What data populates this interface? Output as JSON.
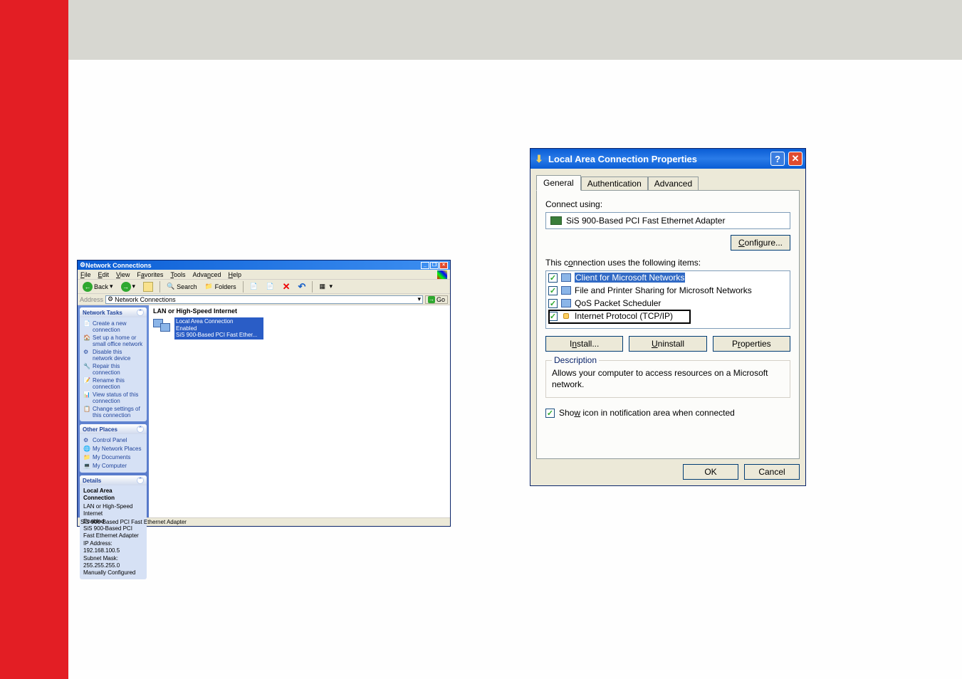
{
  "nc": {
    "title": "Network Connections",
    "menu": {
      "file": "File",
      "edit": "Edit",
      "view": "View",
      "fav": "Favorites",
      "tools": "Tools",
      "adv": "Advanced",
      "help": "Help"
    },
    "tool": {
      "back": "Back",
      "search": "Search",
      "folders": "Folders"
    },
    "addr": {
      "label": "Address",
      "value": "Network Connections",
      "go": "Go"
    },
    "tasks": {
      "title": "Network Tasks",
      "items": [
        "Create a new connection",
        "Set up a home or small office network",
        "Disable this network device",
        "Repair this connection",
        "Rename this connection",
        "View status of this connection",
        "Change settings of this connection"
      ]
    },
    "places": {
      "title": "Other Places",
      "items": [
        "Control Panel",
        "My Network Places",
        "My Documents",
        "My Computer"
      ]
    },
    "details": {
      "title": "Details",
      "name": "Local Area Connection",
      "type": "LAN or High-Speed Internet",
      "status": "Enabled",
      "device": "SiS 900-Based PCI Fast Ethernet Adapter",
      "ip": "IP Address: 192.168.100.5",
      "mask": "Subnet Mask: 255.255.255.0",
      "cfg": "Manually Configured"
    },
    "content": {
      "category": "LAN or High-Speed Internet",
      "item_name": "Local Area Connection",
      "item_status": "Enabled",
      "item_device": "SiS 900-Based PCI Fast Ether..."
    },
    "status": "SiS 900-Based PCI Fast Ethernet Adapter"
  },
  "dlg": {
    "title": "Local Area Connection Properties",
    "tabs": {
      "general": "General",
      "auth": "Authentication",
      "advanced": "Advanced"
    },
    "connect_using": "Connect using:",
    "adapter": "SiS 900-Based PCI Fast Ethernet Adapter",
    "configure": "Configure...",
    "items_label": "This connection uses the following items:",
    "items": [
      "Client for Microsoft Networks",
      "File and Printer Sharing for Microsoft Networks",
      "QoS Packet Scheduler",
      "Internet Protocol (TCP/IP)"
    ],
    "install": "Install...",
    "uninstall": "Uninstall",
    "properties": "Properties",
    "desc_title": "Description",
    "desc": "Allows your computer to access resources on a Microsoft network.",
    "show": "Show icon in notification area when connected",
    "ok": "OK",
    "cancel": "Cancel"
  }
}
